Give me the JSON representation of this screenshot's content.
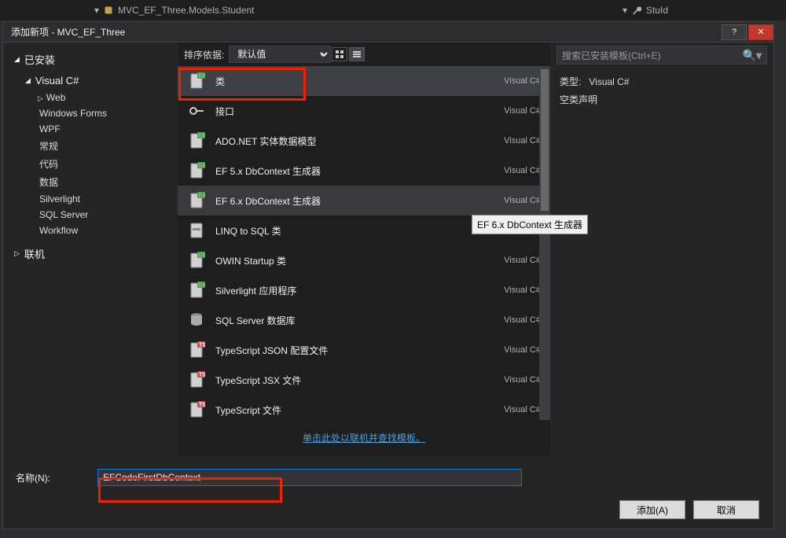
{
  "topbar": {
    "breadcrumb": "MVC_EF_Three.Models.Student",
    "breadcrumb_right": "StuId"
  },
  "dialog_title": "添加新项 - MVC_EF_Three",
  "installed_label": "已安装",
  "online_label": "联机",
  "csharp_label": "Visual C#",
  "tree": {
    "items": [
      "Web",
      "Windows Forms",
      "WPF",
      "常规",
      "代码",
      "数据",
      "Silverlight",
      "SQL Server",
      "Workflow"
    ]
  },
  "sort": {
    "label": "排序依据:",
    "value": "默认值"
  },
  "templates": [
    {
      "label": "类",
      "lang": "Visual C#",
      "icon": "class"
    },
    {
      "label": "接口",
      "lang": "Visual C#",
      "icon": "interface"
    },
    {
      "label": "ADO.NET 实体数据模型",
      "lang": "Visual C#",
      "icon": "ado"
    },
    {
      "label": "EF 5.x DbContext 生成器",
      "lang": "Visual C#",
      "icon": "ef"
    },
    {
      "label": "EF 6.x DbContext 生成器",
      "lang": "Visual C#",
      "icon": "ef"
    },
    {
      "label": "LINQ to SQL 类",
      "lang": "Visual C#",
      "icon": "linq"
    },
    {
      "label": "OWIN Startup 类",
      "lang": "Visual C#",
      "icon": "class"
    },
    {
      "label": "Silverlight 应用程序",
      "lang": "Visual C#",
      "icon": "silverlight"
    },
    {
      "label": "SQL Server 数据库",
      "lang": "Visual C#",
      "icon": "db"
    },
    {
      "label": "TypeScript JSON 配置文件",
      "lang": "Visual C#",
      "icon": "ts"
    },
    {
      "label": "TypeScript JSX 文件",
      "lang": "Visual C#",
      "icon": "ts"
    },
    {
      "label": "TypeScript 文件",
      "lang": "Visual C#",
      "icon": "ts"
    }
  ],
  "selected_index": 0,
  "hover_index": 4,
  "online_link": "单击此处以联机并查找模板。",
  "search_placeholder": "搜索已安装模板(Ctrl+E)",
  "desc": {
    "type_label": "类型:",
    "type_value": "Visual C#",
    "text": "空类声明"
  },
  "name_label": "名称(N):",
  "name_value": "EFCodeFirstDbContext",
  "buttons": {
    "add": "添加(A)",
    "cancel": "取消"
  },
  "tooltip": "EF 6.x DbContext 生成器"
}
